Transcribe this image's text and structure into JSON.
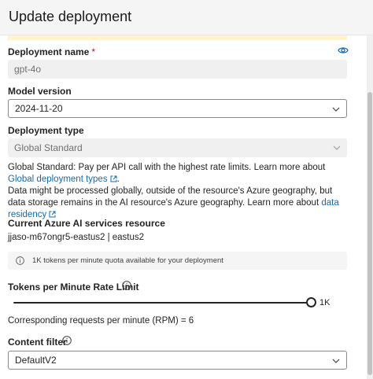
{
  "header": {
    "title": "Update deployment"
  },
  "deployment_name": {
    "label": "Deployment name",
    "required_mark": "*",
    "value": "gpt-4o",
    "reveal_icon": "eye-icon"
  },
  "model_version": {
    "label": "Model version",
    "value": "2024-11-20"
  },
  "deployment_type": {
    "label": "Deployment type",
    "value": "Global Standard",
    "desc_prefix": "Global Standard: Pay per API call with the highest rate limits. Learn more about",
    "desc_link": "Global deployment types",
    "note_prefix": "Data might be processed globally, outside of the resource's Azure geography, but data storage remains in the AI resource's Azure geography. Learn more about",
    "note_link": "data residency"
  },
  "resource": {
    "label": "Current Azure AI services resource",
    "value": "jjaso-m67ongr5-eastus2 | eastus2"
  },
  "quota_info": {
    "text": "1K tokens per minute quota available for your deployment"
  },
  "rate_limit": {
    "label": "Tokens per Minute Rate Limit",
    "value_label": "1K",
    "fill_fraction": 1.0,
    "rpm_text": "Corresponding requests per minute (RPM) = 6"
  },
  "content_filter": {
    "label": "Content filter",
    "value": "DefaultV2"
  },
  "colors": {
    "link": "#0f6cbd",
    "required": "#c50f1f",
    "banner": "#fff4ce",
    "header_bg": "#f5f5f5"
  }
}
